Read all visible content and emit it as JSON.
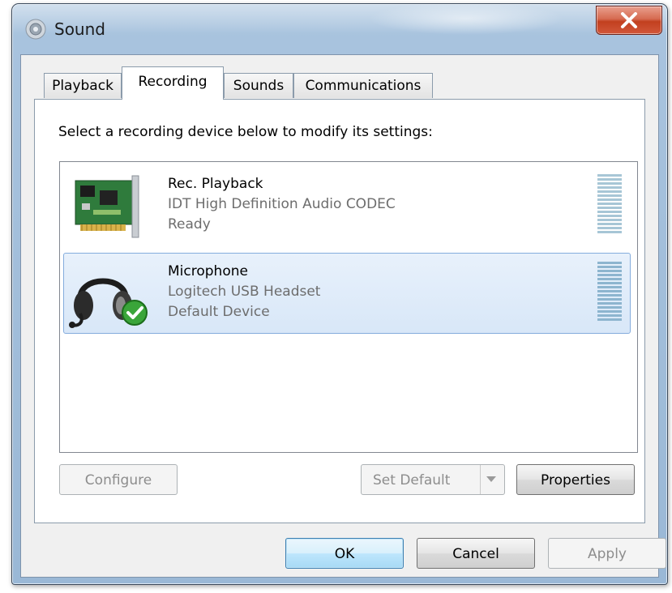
{
  "window": {
    "title": "Sound"
  },
  "tabs": [
    {
      "label": "Playback"
    },
    {
      "label": "Recording",
      "active": true
    },
    {
      "label": "Sounds"
    },
    {
      "label": "Communications"
    }
  ],
  "recording": {
    "instruction": "Select a recording device below to modify its settings:",
    "devices": [
      {
        "name": "Rec. Playback",
        "description": "IDT High Definition Audio CODEC",
        "status": "Ready",
        "icon": "sound-card-icon",
        "selected": false
      },
      {
        "name": "Microphone",
        "description": "Logitech USB Headset",
        "status": "Default Device",
        "icon": "headset-icon",
        "selected": true,
        "default": true
      }
    ],
    "buttons": {
      "configure": "Configure",
      "set_default": "Set Default",
      "properties": "Properties"
    }
  },
  "dialog_buttons": {
    "ok": "OK",
    "cancel": "Cancel",
    "apply": "Apply"
  },
  "colors": {
    "title_bar": "#a8c3de",
    "close_button": "#c2401f",
    "selection": "#d8e7f8",
    "level_meter": "#a7c6d6"
  }
}
